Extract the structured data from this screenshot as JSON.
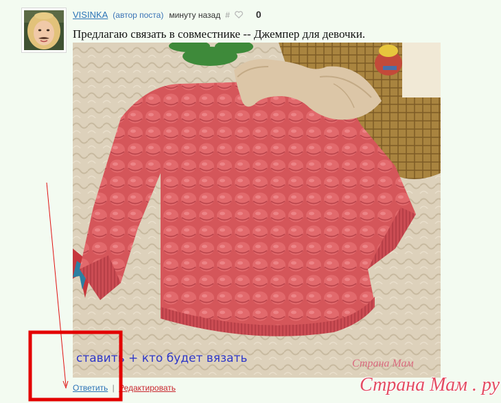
{
  "post": {
    "author": "VISINKA",
    "role": "(автор поста)",
    "time": "минуту назад",
    "hash": "#",
    "likes": "0",
    "text": "Предлагаю связать в совместнике -- Джемпер для девочки."
  },
  "image": {
    "overlay_text": "ставить + кто будет вязать",
    "watermark": "Страна Мам"
  },
  "actions": {
    "reply": "Ответить",
    "separator": "|",
    "edit": "Редактировать"
  },
  "site_watermark": "Страна Мам . ру",
  "colors": {
    "link": "#2b73b7",
    "highlight_box": "#e30000",
    "overlay_text": "#2d37c8"
  }
}
